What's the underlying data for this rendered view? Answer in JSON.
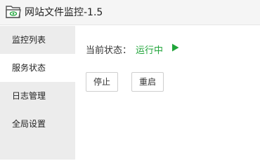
{
  "app": {
    "title": "网站文件监控-1.5"
  },
  "sidebar": {
    "items": [
      {
        "label": "监控列表",
        "active": false
      },
      {
        "label": "服务状态",
        "active": true
      },
      {
        "label": "日志管理",
        "active": false
      },
      {
        "label": "全局设置",
        "active": false
      }
    ]
  },
  "main": {
    "status_label": "当前状态：",
    "status_value": "运行中",
    "stop_label": "停止",
    "restart_label": "重启"
  },
  "colors": {
    "running": "#20a53a",
    "sidebar_bg": "#ececec"
  },
  "icons": {
    "app": "folder-eye-icon",
    "status": "play-icon"
  }
}
